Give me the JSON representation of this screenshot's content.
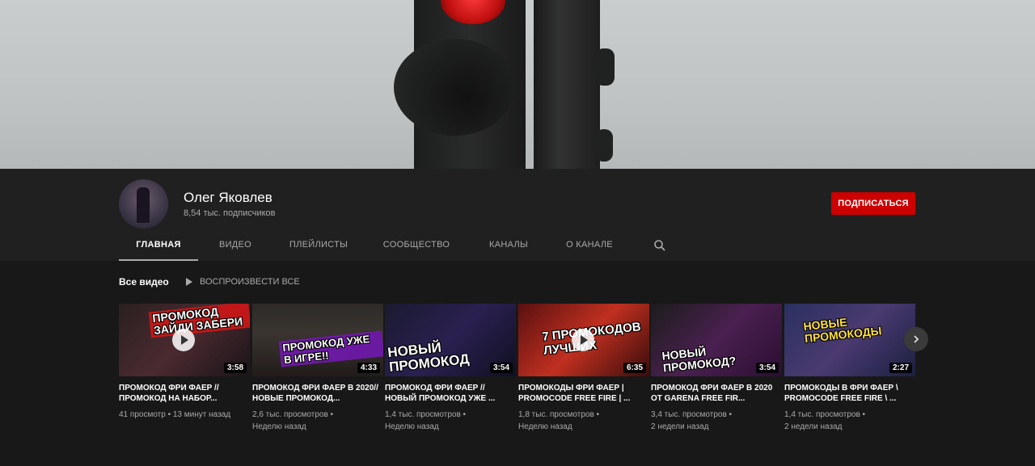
{
  "channel": {
    "name": "Олег Яковлев",
    "subscribers": "8,54 тыс. подписчиков",
    "subscribe_label": "ПОДПИСАТЬСЯ"
  },
  "tabs": [
    {
      "label": "ГЛАВНАЯ",
      "active": true
    },
    {
      "label": "ВИДЕО"
    },
    {
      "label": "ПЛЕЙЛИСТЫ"
    },
    {
      "label": "СООБЩЕСТВО"
    },
    {
      "label": "КАНАЛЫ"
    },
    {
      "label": "О КАНАЛЕ"
    }
  ],
  "section": {
    "title": "Все видео",
    "play_all": "ВОСПРОИЗВЕСТИ ВСЕ"
  },
  "videos": [
    {
      "title": "ПРОМОКОД ФРИ ФАЕР // ПРОМОКОД НА НАБОР...",
      "meta1": "41 просмотр • 13 минут назад",
      "meta2": "",
      "duration": "3:58",
      "thumb_text": "ПРОМОКОД ЗАЙДИ ЗАБЕРИ"
    },
    {
      "title": "ПРОМОКОД ФРИ ФАЕР В 2020//НОВЫЕ ПРОМОКОД...",
      "meta1": "2,6 тыс. просмотров •",
      "meta2": "Неделю назад",
      "duration": "4:33",
      "thumb_text": "ПРОМОКОД УЖЕ В ИГРЕ!!"
    },
    {
      "title": "ПРОМОКОД ФРИ ФАЕР // НОВЫЙ ПРОМОКОД УЖЕ ...",
      "meta1": "1,4 тыс. просмотров •",
      "meta2": "Неделю назад",
      "duration": "3:54",
      "thumb_text": "НОВЫЙ ПРОМОКОД"
    },
    {
      "title": "ПРОМОКОДЫ ФРИ ФАЕР | PROMOCODE FREE FIRE | ...",
      "meta1": "1,8 тыс. просмотров •",
      "meta2": "Неделю назад",
      "duration": "6:35",
      "thumb_text": "7 ПРОМОКОДОВ ЛУЧШИХ"
    },
    {
      "title": "ПРОМОКОД ФРИ ФАЕР В 2020 ОТ GARENA FREE FIR...",
      "meta1": "3,4 тыс. просмотров •",
      "meta2": "2 недели назад",
      "duration": "3:54",
      "thumb_text": "НОВЫЙ ПРОМОКОД?"
    },
    {
      "title": "ПРОМОКОДЫ В ФРИ ФАЕР \\ PROMOCODE FREE FIRE \\ ...",
      "meta1": "1,4 тыс. просмотров •",
      "meta2": "2 недели назад",
      "duration": "2:27",
      "thumb_text": "НОВЫЕ ПРОМОКОДЫ"
    }
  ],
  "colors": {
    "accent": "#cc0000",
    "bg": "#181818",
    "header": "#202020"
  }
}
